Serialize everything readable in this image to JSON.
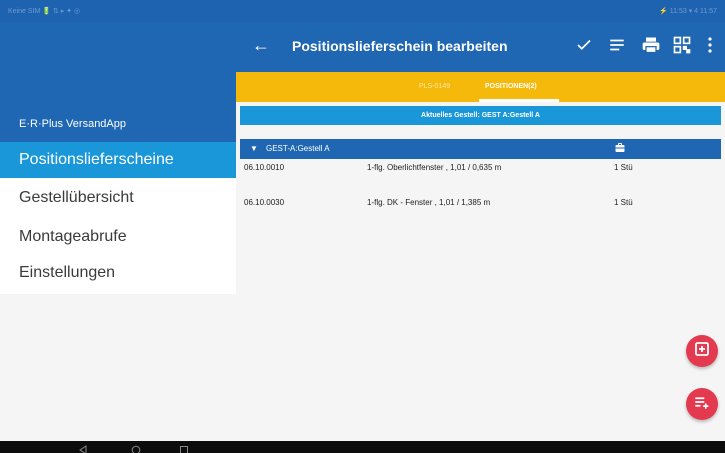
{
  "statusbar": {
    "left": "Keine SIM 🔋 ⇅ ▸ ✦ ◎",
    "right": "⚡ 11:53 ▾ 4 11:57"
  },
  "toolbar": {
    "title": "Positionslieferschein bearbeiten",
    "icons": [
      "arrow-back-icon",
      "check-icon",
      "sort-lines-icon",
      "print-icon",
      "qr-code-icon",
      "more-vert-icon"
    ]
  },
  "tabs": [
    {
      "label": "PLS-0149",
      "active": false
    },
    {
      "label": "POSITIONEN(2)",
      "active": true
    }
  ],
  "sidebar": {
    "app_name": "E·R·Plus VersandApp",
    "items": [
      {
        "label": "Positionslieferscheine",
        "active": true
      },
      {
        "label": "Gestellübersicht",
        "active": false
      },
      {
        "label": "Montageabrufe",
        "active": false
      },
      {
        "label": "Einstellungen",
        "active": false
      }
    ]
  },
  "banner": "Aktuelles Gestell: GEST A:Gestell A",
  "group": {
    "label": "GEST-A:Gestell A",
    "icon": "cart-icon"
  },
  "rows": [
    {
      "code": "06.10.0010",
      "description": "1-flg. Oberlichtfenster ,  1,01 / 0,635 m",
      "qty": "1 Stü"
    },
    {
      "code": "06.10.0030",
      "description": "1-flg. DK - Fenster ,  1,01 / 1,385 m",
      "qty": "1 Stü"
    }
  ],
  "fabs": [
    "add-to-cart-icon",
    "add-list-icon"
  ],
  "colors": {
    "primary": "#1f66b3",
    "accent": "#f5b90b",
    "highlight": "#1a97d9",
    "fab": "#e43a4f"
  }
}
